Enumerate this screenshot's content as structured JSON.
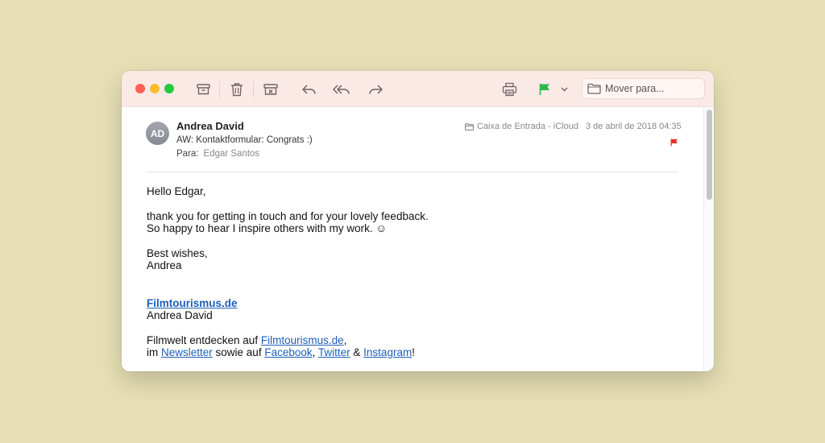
{
  "window": {
    "traffic_lights": {
      "close": "#ff5f57",
      "minimize": "#febc2e",
      "zoom": "#28c840"
    },
    "toolbar": {
      "buttons": [
        "archive-icon",
        "trash-icon",
        "junk-icon",
        "reply-icon",
        "reply-all-icon",
        "forward-icon",
        "print-icon",
        "flag-icon",
        "chevron-down-icon"
      ],
      "flag_color": "#2db84d",
      "move_placeholder": "Mover para..."
    }
  },
  "message": {
    "avatar_initials": "AD",
    "sender": "Andrea David",
    "subject": "AW: Kontaktformular: Congrats :)",
    "to_label": "Para:",
    "to_value": "Edgar Santos",
    "mailbox": "Caixa de Entrada - iCloud",
    "date": "3 de abril de 2018 04:35",
    "flag_color": "#e5332a"
  },
  "body": {
    "greeting": "Hello Edgar,",
    "line1": "thank you for getting in touch and for your lovely feedback.",
    "line2": "So happy to hear I inspire others with my work. ☺",
    "closing": "Best wishes,",
    "signoff": "Andrea",
    "sig_link": "Filmtourismus.de",
    "sig_name": "Andrea David",
    "promo_prefix": "Filmwelt entdecken auf ",
    "promo_link": "Filmtourismus.de",
    "promo_comma": ",",
    "promo_line2_prefix": "im ",
    "newsletter_link": "Newsletter",
    "sowie_auf": " sowie auf ",
    "facebook_link": "Facebook",
    "comma_sep": ", ",
    "twitter_link": "Twitter",
    "amp_sep": " & ",
    "instagram_link": "Instagram",
    "promo_end": "!"
  }
}
